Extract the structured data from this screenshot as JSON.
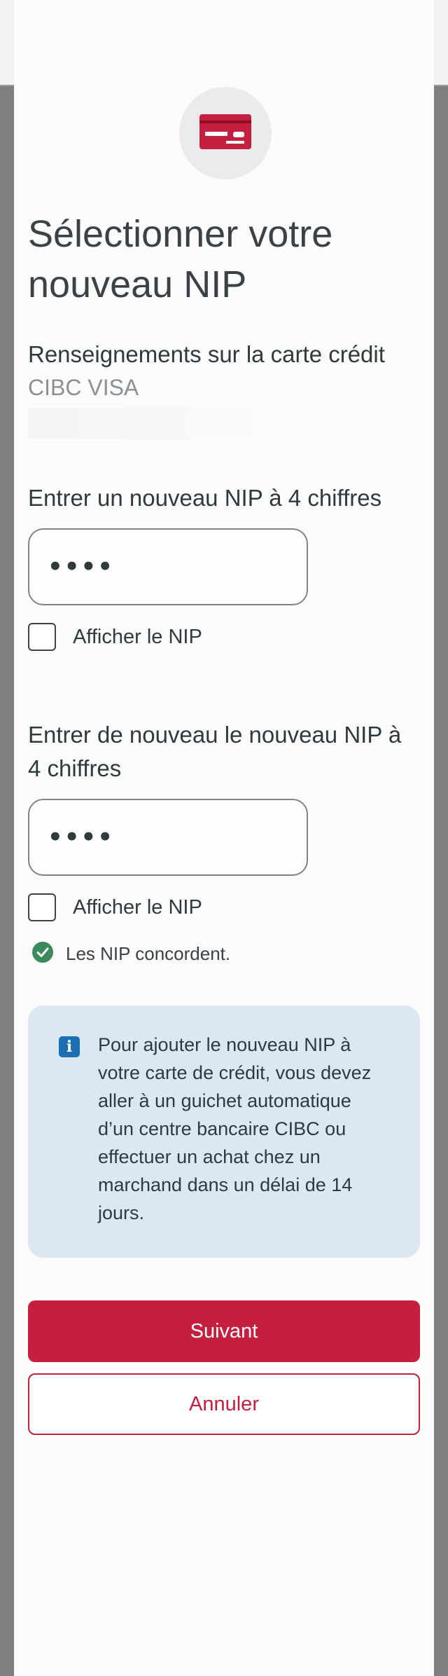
{
  "colors": {
    "brand": "#c41f3e",
    "info_background": "#dce7f4",
    "info_icon": "#1d6fb3",
    "success": "#3a8a5c"
  },
  "header": {
    "icon": "credit-card-icon",
    "title": "Sélectionner votre nouveau NIP"
  },
  "card_info": {
    "label": "Renseignements sur la carte crédit",
    "card_type": "CIBC VISA"
  },
  "new_pin": {
    "label": "Entrer un nouveau NIP à 4 chiffres",
    "value": "••••",
    "show_pin_label": "Afficher le NIP",
    "show_pin_checked": false
  },
  "confirm_pin": {
    "label": "Entrer de nouveau le nouveau NIP à 4 chiffres",
    "value": "••••",
    "show_pin_label": "Afficher le NIP",
    "show_pin_checked": false
  },
  "validation": {
    "icon": "check-circle-icon",
    "message": "Les NIP concordent."
  },
  "info": {
    "icon": "info-icon",
    "glyph": "i",
    "text": "Pour ajouter le nouveau NIP à votre carte de crédit, vous devez aller à un guichet automatique d’un centre bancaire CIBC ou effectuer un achat chez un marchand dans un délai de 14 jours."
  },
  "actions": {
    "next_label": "Suivant",
    "cancel_label": "Annuler"
  }
}
